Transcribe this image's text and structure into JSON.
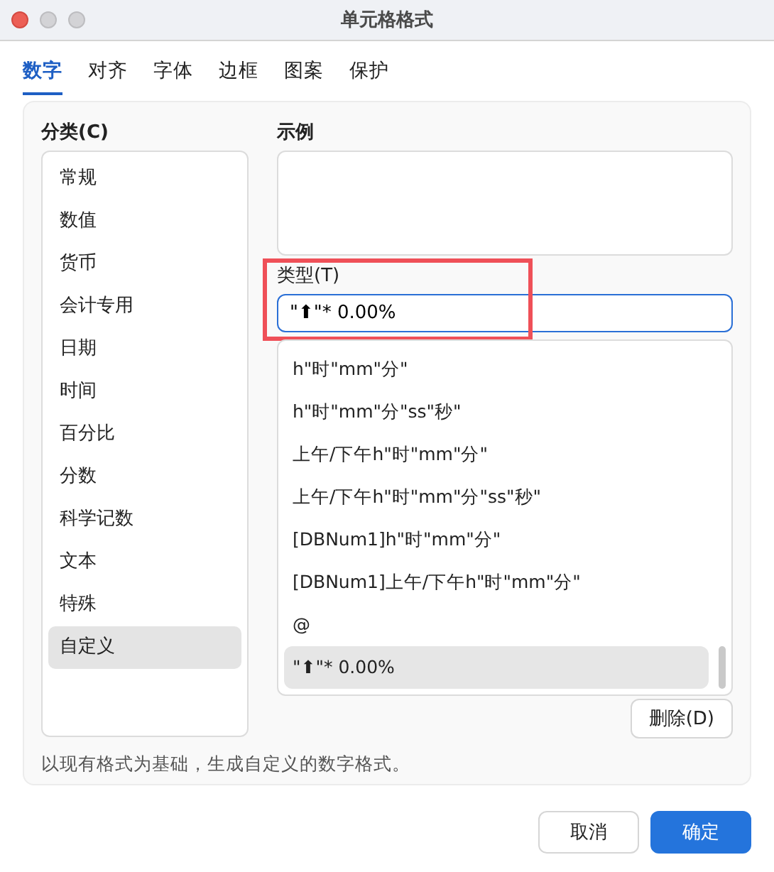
{
  "window": {
    "title": "单元格格式"
  },
  "tabs": [
    {
      "label": "数字",
      "selected": true
    },
    {
      "label": "对齐",
      "selected": false
    },
    {
      "label": "字体",
      "selected": false
    },
    {
      "label": "边框",
      "selected": false
    },
    {
      "label": "图案",
      "selected": false
    },
    {
      "label": "保护",
      "selected": false
    }
  ],
  "category": {
    "label": "分类(C)",
    "items": [
      {
        "label": "常规",
        "selected": false
      },
      {
        "label": "数值",
        "selected": false
      },
      {
        "label": "货币",
        "selected": false
      },
      {
        "label": "会计专用",
        "selected": false
      },
      {
        "label": "日期",
        "selected": false
      },
      {
        "label": "时间",
        "selected": false
      },
      {
        "label": "百分比",
        "selected": false
      },
      {
        "label": "分数",
        "selected": false
      },
      {
        "label": "科学记数",
        "selected": false
      },
      {
        "label": "文本",
        "selected": false
      },
      {
        "label": "特殊",
        "selected": false
      },
      {
        "label": "自定义",
        "selected": true
      }
    ]
  },
  "sample": {
    "label": "示例"
  },
  "type_field": {
    "label": "类型(T)",
    "value": "\"⬆\"* 0.00%",
    "highlighted": true
  },
  "formats": [
    {
      "label": "h\"时\"mm\"分\"",
      "selected": false
    },
    {
      "label": "h\"时\"mm\"分\"ss\"秒\"",
      "selected": false
    },
    {
      "label": "上午/下午h\"时\"mm\"分\"",
      "selected": false
    },
    {
      "label": "上午/下午h\"时\"mm\"分\"ss\"秒\"",
      "selected": false
    },
    {
      "label": "[DBNum1]h\"时\"mm\"分\"",
      "selected": false
    },
    {
      "label": "[DBNum1]上午/下午h\"时\"mm\"分\"",
      "selected": false
    },
    {
      "label": "@",
      "selected": false
    },
    {
      "label": "\"⬆\"* 0.00%",
      "selected": true
    }
  ],
  "delete_button": "删除(D)",
  "hint": "以现有格式为基础，生成自定义的数字格式。",
  "buttons": [
    {
      "label": "取消",
      "kind": "secondary"
    },
    {
      "label": "确定",
      "kind": "primary"
    }
  ]
}
